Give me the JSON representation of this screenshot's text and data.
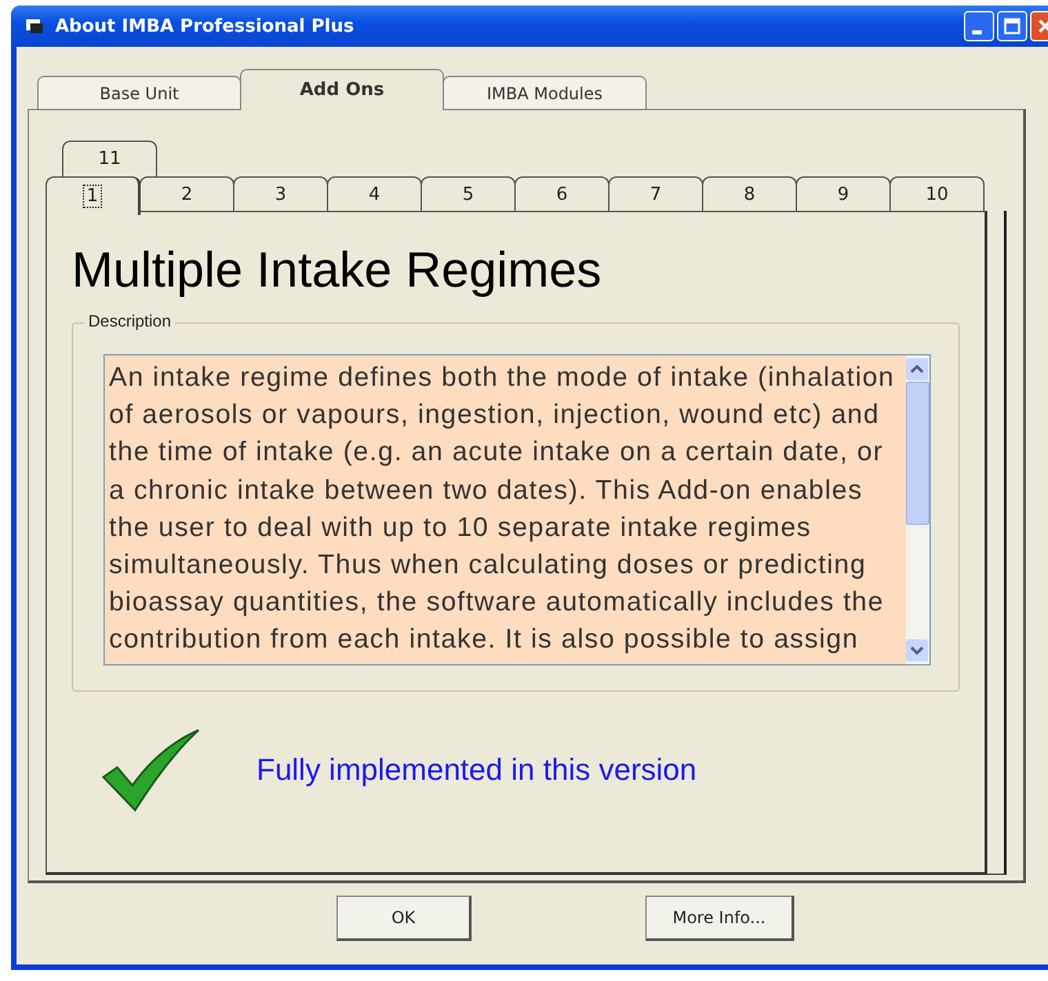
{
  "window": {
    "title": "About IMBA Professional Plus"
  },
  "tabs": [
    {
      "label": "Base Unit",
      "selected": false
    },
    {
      "label": "Add Ons",
      "selected": true
    },
    {
      "label": "IMBA Modules",
      "selected": false
    }
  ],
  "addon_tab_rows": [
    {
      "tabs": [
        {
          "label": "11",
          "selected": false
        }
      ]
    },
    {
      "tabs": [
        {
          "label": "1",
          "selected": true
        },
        {
          "label": "2",
          "selected": false
        },
        {
          "label": "3",
          "selected": false
        },
        {
          "label": "4",
          "selected": false
        },
        {
          "label": "5",
          "selected": false
        },
        {
          "label": "6",
          "selected": false
        },
        {
          "label": "7",
          "selected": false
        },
        {
          "label": "8",
          "selected": false
        },
        {
          "label": "9",
          "selected": false
        },
        {
          "label": "10",
          "selected": false
        }
      ]
    }
  ],
  "addon": {
    "heading": "Multiple Intake Regimes",
    "group_label": "Description",
    "description": "An intake regime defines both the mode of intake (inhalation of aerosols or vapours, ingestion, injection, wound etc) and the time of intake (e.g. an acute intake on a certain date, or a chronic intake between two dates).  This Add-on enables the user to deal with up to 10 separate intake regimes simultaneously. Thus when calculating doses or predicting bioassay quantities, the software automatically includes the contribution from each intake.  It is also possible to assign",
    "implemented": true,
    "status": "Fully implemented in this version"
  },
  "buttons": [
    "OK",
    "More Info..."
  ]
}
